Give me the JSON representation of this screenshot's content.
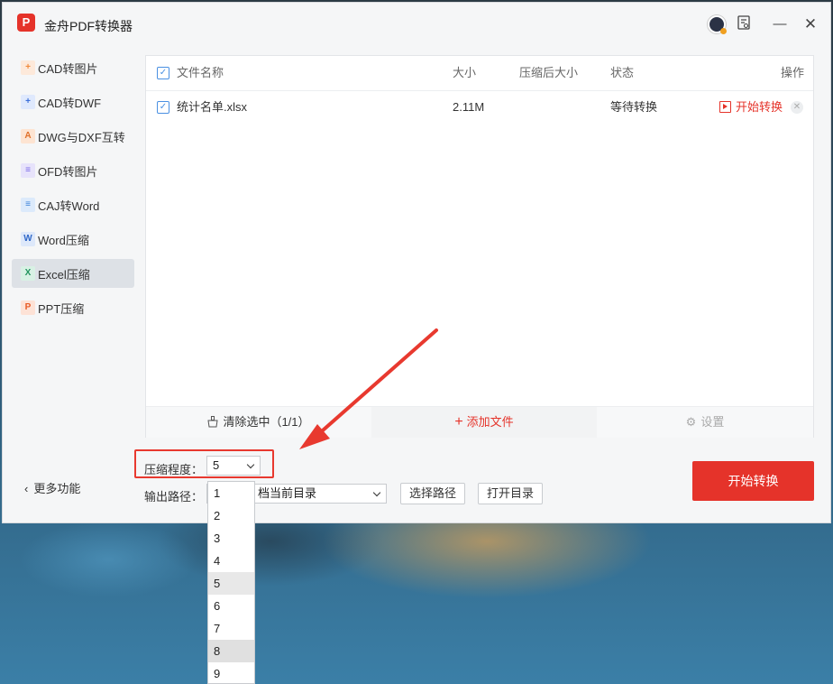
{
  "app": {
    "logo_text": "P",
    "title": "金舟PDF转换器"
  },
  "titlebar": {
    "minimize": "—",
    "close": "✕"
  },
  "sidebar": {
    "items": [
      {
        "label": "CAD转图片",
        "icon": "cad-image-icon",
        "color": "#f5a15a"
      },
      {
        "label": "CAD转DWF",
        "icon": "cad-dwf-icon",
        "color": "#5b8ff9"
      },
      {
        "label": "DWG与DXF互转",
        "icon": "dwg-dxf-icon",
        "color": "#f08a3c"
      },
      {
        "label": "OFD转图片",
        "icon": "ofd-image-icon",
        "color": "#8b7cf6"
      },
      {
        "label": "CAJ转Word",
        "icon": "caj-word-icon",
        "color": "#4a90e2"
      },
      {
        "label": "Word压缩",
        "icon": "word-compress-icon",
        "color": "#3b7be0"
      },
      {
        "label": "Excel压缩",
        "icon": "excel-compress-icon",
        "color": "#2fa36b",
        "active": true
      },
      {
        "label": "PPT压缩",
        "icon": "ppt-compress-icon",
        "color": "#f06a35"
      }
    ],
    "more": "更多功能"
  },
  "table": {
    "headers": {
      "name": "文件名称",
      "size": "大小",
      "compressed": "压缩后大小",
      "status": "状态",
      "ops": "操作"
    },
    "rows": [
      {
        "name": "统计名单.xlsx",
        "size": "2.11M",
        "compressed": "",
        "status": "等待转换",
        "action": "开始转换"
      }
    ]
  },
  "actions": {
    "clear": "清除选中（1/1）",
    "add": "添加文件",
    "settings": "设置"
  },
  "controls": {
    "compress_label": "压缩程度：",
    "compress_value": "5",
    "compress_options": [
      "1",
      "2",
      "3",
      "4",
      "5",
      "6",
      "7",
      "8",
      "9"
    ],
    "output_label": "输出路径：",
    "output_value": "档当前目录",
    "choose_path": "选择路径",
    "open_dir": "打开目录",
    "start": "开始转换"
  },
  "colors": {
    "accent": "#e5332a",
    "annotation": "#e8392f"
  }
}
